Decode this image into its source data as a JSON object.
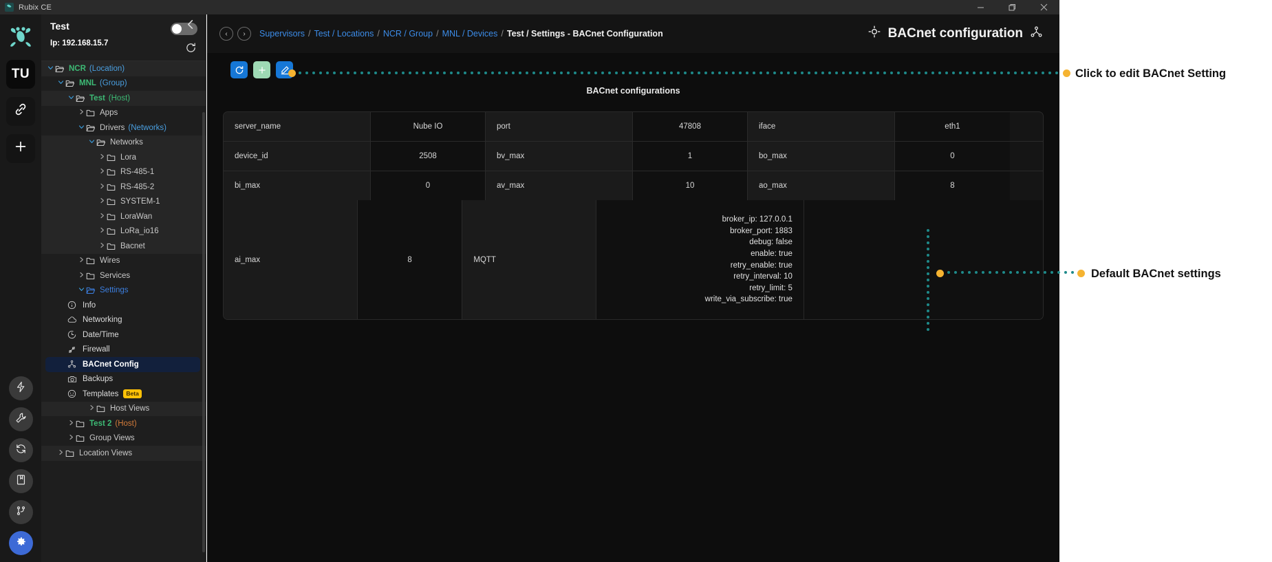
{
  "window": {
    "app_title": "Rubix CE",
    "minimize_label": "minimize",
    "maximize_label": "maximize",
    "close_label": "close"
  },
  "rail": {
    "logo_name": "frog-logo",
    "items": [
      {
        "name": "tu-workspace",
        "label": "TU"
      },
      {
        "name": "link-icon",
        "label": ""
      },
      {
        "name": "plus-icon",
        "label": ""
      }
    ],
    "bottom_items": [
      {
        "name": "bolt-icon"
      },
      {
        "name": "wrench-icon"
      },
      {
        "name": "sync-icon"
      },
      {
        "name": "book-icon"
      },
      {
        "name": "branch-icon"
      },
      {
        "name": "gear-icon"
      }
    ]
  },
  "sidebar": {
    "host_name": "Test",
    "host_ip": "Ip: 192.168.15.7",
    "toggle_on": false,
    "tree": [
      {
        "label": "NCR",
        "suffix": "(Location)",
        "depth": 0,
        "expanded": true,
        "label_class": "c-green bold",
        "suffix_class": "c-ltblue",
        "folder": "open",
        "alt": true
      },
      {
        "label": "MNL",
        "suffix": "(Group)",
        "depth": 1,
        "expanded": true,
        "label_class": "c-green bold",
        "suffix_class": "c-ltblue",
        "folder": "open",
        "alt": false
      },
      {
        "label": "Test",
        "suffix": "(Host)",
        "depth": 2,
        "expanded": true,
        "label_class": "c-green bold",
        "suffix_class": "c-green",
        "folder": "open",
        "alt": true
      },
      {
        "label": "Apps",
        "suffix": "",
        "depth": 3,
        "expanded": false,
        "label_class": "c-grey",
        "suffix_class": "",
        "folder": "closed",
        "alt": false
      },
      {
        "label": "Drivers",
        "suffix": "(Networks)",
        "depth": 3,
        "expanded": true,
        "label_class": "c-grey",
        "suffix_class": "c-ltblue",
        "folder": "open",
        "alt": false
      },
      {
        "label": "Networks",
        "suffix": "",
        "depth": 4,
        "expanded": true,
        "label_class": "c-grey",
        "suffix_class": "",
        "folder": "open",
        "alt": true
      },
      {
        "label": "Lora",
        "suffix": "",
        "depth": 5,
        "expanded": false,
        "label_class": "c-grey",
        "suffix_class": "",
        "folder": "closed",
        "alt": true
      },
      {
        "label": "RS-485-1",
        "suffix": "",
        "depth": 5,
        "expanded": false,
        "label_class": "c-grey",
        "suffix_class": "",
        "folder": "closed",
        "alt": true
      },
      {
        "label": "RS-485-2",
        "suffix": "",
        "depth": 5,
        "expanded": false,
        "label_class": "c-grey",
        "suffix_class": "",
        "folder": "closed",
        "alt": true
      },
      {
        "label": "SYSTEM-1",
        "suffix": "",
        "depth": 5,
        "expanded": false,
        "label_class": "c-grey",
        "suffix_class": "",
        "folder": "closed",
        "alt": true
      },
      {
        "label": "LoraWan",
        "suffix": "",
        "depth": 5,
        "expanded": false,
        "label_class": "c-grey",
        "suffix_class": "",
        "folder": "closed",
        "alt": true
      },
      {
        "label": "LoRa_io16",
        "suffix": "",
        "depth": 5,
        "expanded": false,
        "label_class": "c-grey",
        "suffix_class": "",
        "folder": "closed",
        "alt": true
      },
      {
        "label": "Bacnet",
        "suffix": "",
        "depth": 5,
        "expanded": false,
        "label_class": "c-grey",
        "suffix_class": "",
        "folder": "closed",
        "alt": true
      },
      {
        "label": "Wires",
        "suffix": "",
        "depth": 3,
        "expanded": false,
        "label_class": "c-grey",
        "suffix_class": "",
        "folder": "closed",
        "alt": false
      },
      {
        "label": "Services",
        "suffix": "",
        "depth": 3,
        "expanded": false,
        "label_class": "c-grey",
        "suffix_class": "",
        "folder": "closed",
        "alt": false
      },
      {
        "label": "Settings",
        "suffix": "",
        "depth": 3,
        "expanded": true,
        "label_class": "c-blue",
        "suffix_class": "",
        "folder": "open-blue",
        "alt": false
      }
    ],
    "settings_items": [
      {
        "label": "Info",
        "icon": "info-icon",
        "active": false,
        "beta": false
      },
      {
        "label": "Networking",
        "icon": "cloud-icon",
        "active": false,
        "beta": false
      },
      {
        "label": "Date/Time",
        "icon": "clock-icon",
        "active": false,
        "beta": false
      },
      {
        "label": "Firewall",
        "icon": "firewall-icon",
        "active": false,
        "beta": false
      },
      {
        "label": "BACnet Config",
        "icon": "bacnet-icon",
        "active": true,
        "beta": false
      },
      {
        "label": "Backups",
        "icon": "camera-icon",
        "active": false,
        "beta": false
      },
      {
        "label": "Templates",
        "icon": "template-icon",
        "active": false,
        "beta": true,
        "beta_label": "Beta"
      }
    ],
    "tree_tail": [
      {
        "label": "Host Views",
        "suffix": "",
        "depth": 4,
        "expanded": false,
        "label_class": "c-grey",
        "suffix_class": "",
        "folder": "closed",
        "alt": true
      },
      {
        "label": "Test 2",
        "suffix": "(Host)",
        "depth": 2,
        "expanded": false,
        "label_class": "c-green bold",
        "suffix_class": "c-orange",
        "folder": "closed",
        "alt": false
      },
      {
        "label": "Group Views",
        "suffix": "",
        "depth": 2,
        "expanded": false,
        "label_class": "c-grey",
        "suffix_class": "",
        "folder": "closed",
        "alt": false
      },
      {
        "label": "Location Views",
        "suffix": "",
        "depth": 1,
        "expanded": false,
        "label_class": "c-grey",
        "suffix_class": "",
        "folder": "closed",
        "alt": true
      }
    ]
  },
  "header": {
    "back_label": "‹",
    "forward_label": "›",
    "breadcrumbs": [
      {
        "label": "Supervisors",
        "link": true
      },
      {
        "label": "Test / Locations",
        "link": true
      },
      {
        "label": "NCR / Group",
        "link": true
      },
      {
        "label": "MNL / Devices",
        "link": true
      },
      {
        "label": "Test / Settings - BACnet Configuration",
        "link": false
      }
    ],
    "separator": "/",
    "title": "BACnet configuration",
    "title_left_icon": "target-icon",
    "title_right_icon": "bacnet-icon"
  },
  "toolbar": {
    "refresh_label": "refresh-button",
    "add_label": "add-button",
    "edit_label": "edit-button"
  },
  "content": {
    "section_title": "BACnet configurations",
    "rows": [
      [
        {
          "type": "key",
          "text": "server_name"
        },
        {
          "type": "value",
          "text": "Nube IO"
        },
        {
          "type": "key",
          "text": "port"
        },
        {
          "type": "value",
          "text": "47808"
        },
        {
          "type": "key",
          "text": "iface"
        },
        {
          "type": "value",
          "text": "eth1"
        }
      ],
      [
        {
          "type": "key",
          "text": "device_id"
        },
        {
          "type": "value",
          "text": "2508"
        },
        {
          "type": "key",
          "text": "bv_max"
        },
        {
          "type": "value",
          "text": "1"
        },
        {
          "type": "key",
          "text": "bo_max"
        },
        {
          "type": "value",
          "text": "0"
        }
      ],
      [
        {
          "type": "key",
          "text": "bi_max"
        },
        {
          "type": "value",
          "text": "0"
        },
        {
          "type": "key",
          "text": "av_max"
        },
        {
          "type": "value",
          "text": "10"
        },
        {
          "type": "key",
          "text": "ao_max"
        },
        {
          "type": "value",
          "text": "8"
        }
      ]
    ],
    "mqtt_row": {
      "key": "ai_max",
      "value": "8",
      "label": "MQTT",
      "settings": [
        "broker_ip: 127.0.0.1",
        "broker_port: 1883",
        "debug: false",
        "enable: true",
        "retry_enable: true",
        "retry_interval: 10",
        "retry_limit: 5",
        "write_via_subscribe: true"
      ]
    }
  },
  "annotations": [
    {
      "name": "annotation-edit-bacnet",
      "text": "Click to edit BACnet Setting"
    },
    {
      "name": "annotation-default-settings",
      "text": "Default BACnet settings"
    }
  ],
  "colors": {
    "accent_blue": "#1677d6",
    "accent_green": "#9ed9b4",
    "annotation_dot": "#f5b331",
    "annotation_line": "#1e8a8a",
    "active_item": "#12203c"
  }
}
